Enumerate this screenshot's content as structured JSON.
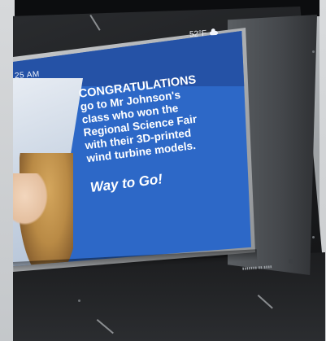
{
  "screen": {
    "clock_text": "25 AM",
    "weather_text": "52°F",
    "weather_icon": "cloud-icon",
    "headline_lines": [
      "CONGRATULATIONS",
      "go to Mr Johnson's",
      "class who won the",
      "Regional Science Fair",
      "with their 3D-printed",
      "wind turbine models."
    ],
    "cheer": "Way to Go!",
    "background_color": "#2d68c7"
  }
}
